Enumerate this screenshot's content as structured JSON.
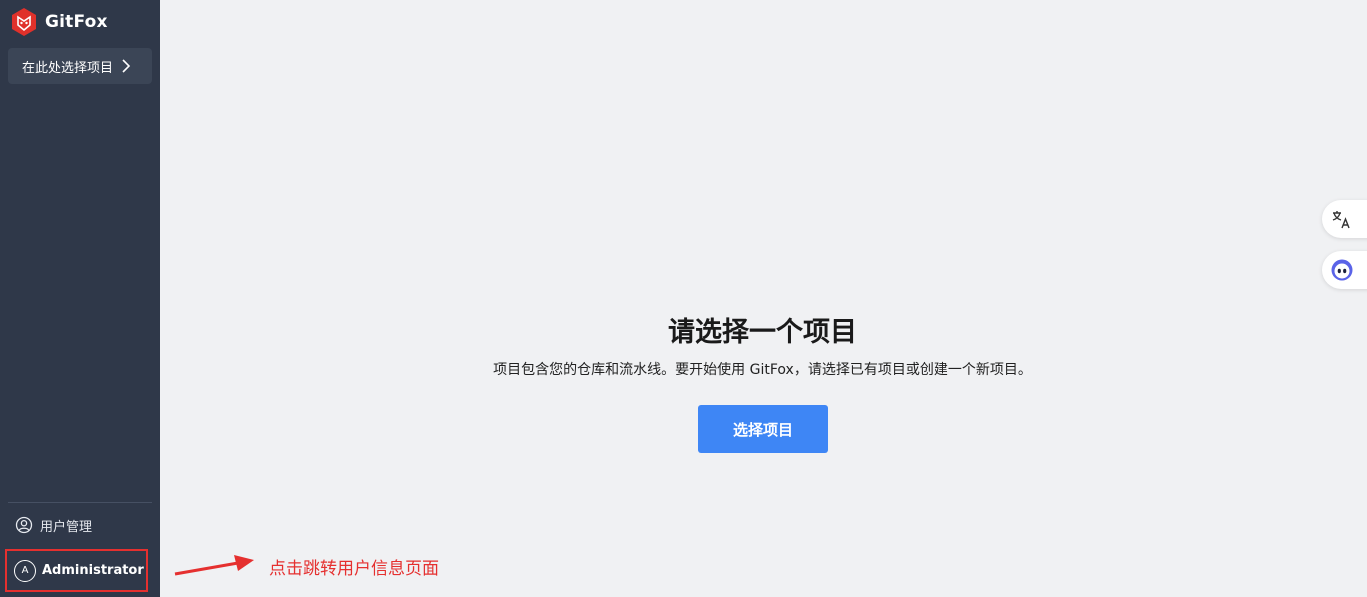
{
  "sidebar": {
    "brand_name": "GitFox",
    "project_select_label": "在此处选择项目",
    "nav_items": [
      {
        "label": "用户管理",
        "icon": "user-circle-icon"
      }
    ],
    "user": {
      "avatar_initial": "A",
      "name": "Administrator"
    }
  },
  "main": {
    "title": "请选择一个项目",
    "description": "项目包含您的仓库和流水线。要开始使用 GitFox，请选择已有项目或创建一个新项目。",
    "select_button_label": "选择项目"
  },
  "floating_buttons": {
    "translate_icon": "translate-icon",
    "assistant_icon": "assistant-icon"
  },
  "annotation": {
    "text": "点击跳转用户信息页面",
    "color": "#e5302f"
  },
  "colors": {
    "sidebar_bg": "#2f3849",
    "main_bg": "#f0f1f3",
    "primary": "#3e86f5",
    "brand_red": "#e0312b"
  }
}
